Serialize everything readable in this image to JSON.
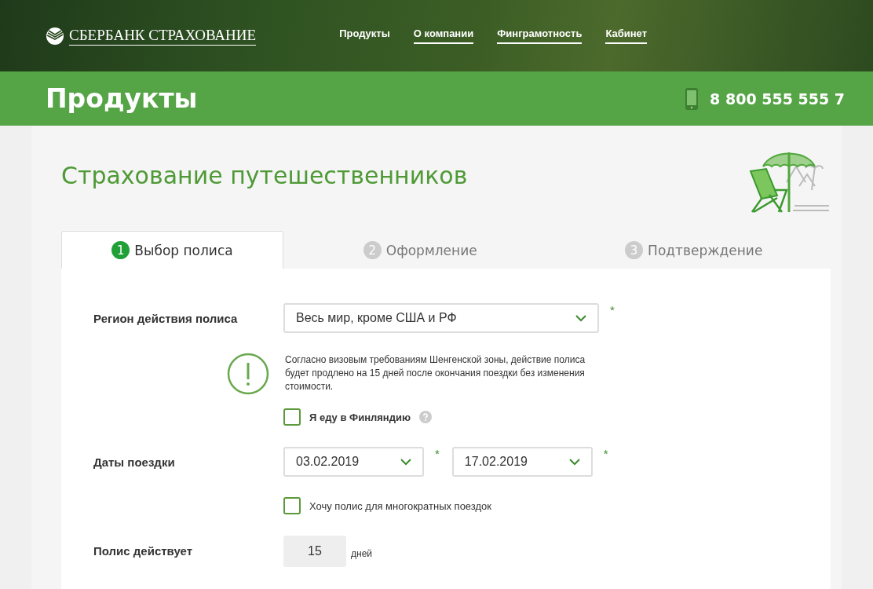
{
  "header": {
    "logo": "СБЕРБАНК СТРАХОВАНИЕ",
    "nav": [
      {
        "label": "Продукты",
        "underlined": false
      },
      {
        "label": "О компании",
        "underlined": true
      },
      {
        "label": "Финграмотность",
        "underlined": true
      },
      {
        "label": "Кабинет",
        "underlined": true
      }
    ]
  },
  "banner": {
    "title": "Продукты",
    "phone": "8 800 555 555 7"
  },
  "page_title": "Страхование путешественников",
  "tabs": [
    {
      "number": "1",
      "label": "Выбор полиса",
      "selected": true
    },
    {
      "number": "2",
      "label": "Оформление",
      "selected": false
    },
    {
      "number": "3",
      "label": "Подтверждение",
      "selected": false
    }
  ],
  "form": {
    "region": {
      "label": "Регион действия полиса",
      "value": "Весь мир, кроме США и РФ",
      "required_mark": "*"
    },
    "notice": "Согласно визовым требованиям Шенгенской зоны, действие полиса будет продлено на 15 дней после окончания поездки без изменения стоимости.",
    "finland": {
      "label": "Я еду в Финляндию",
      "checked": false
    },
    "dates": {
      "label": "Даты поездки",
      "from": "03.02.2019",
      "from_mark": "*",
      "to": "17.02.2019",
      "to_mark": "*"
    },
    "multi": {
      "label": "Хочу полис для многократных поездок",
      "checked": false
    },
    "duration": {
      "label": "Полис действует",
      "value": "15",
      "unit": "дней"
    }
  }
}
